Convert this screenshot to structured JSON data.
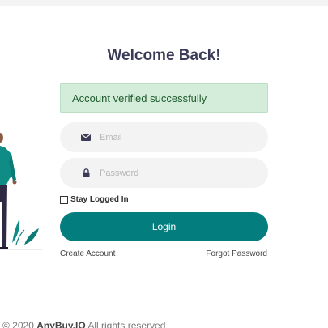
{
  "page": {
    "title": "Welcome Back!"
  },
  "alert": {
    "message": "Account verified successfully"
  },
  "form": {
    "email_placeholder": "Email",
    "password_placeholder": "Password",
    "remember_label": "Stay Logged In",
    "login_label": "Login"
  },
  "links": {
    "create_account": "Create Account",
    "forgot_password": "Forgot Password"
  },
  "footer": {
    "copyright": "© 2020",
    "brand": "AnyBuy.IO",
    "rights": " All rights reserved"
  },
  "icons": {
    "email": "envelope-icon",
    "password": "lock-icon"
  },
  "colors": {
    "accent": "#037d7d",
    "alert_bg": "#d4edda",
    "alert_text": "#1e5b2c",
    "title": "#3b3b58"
  }
}
